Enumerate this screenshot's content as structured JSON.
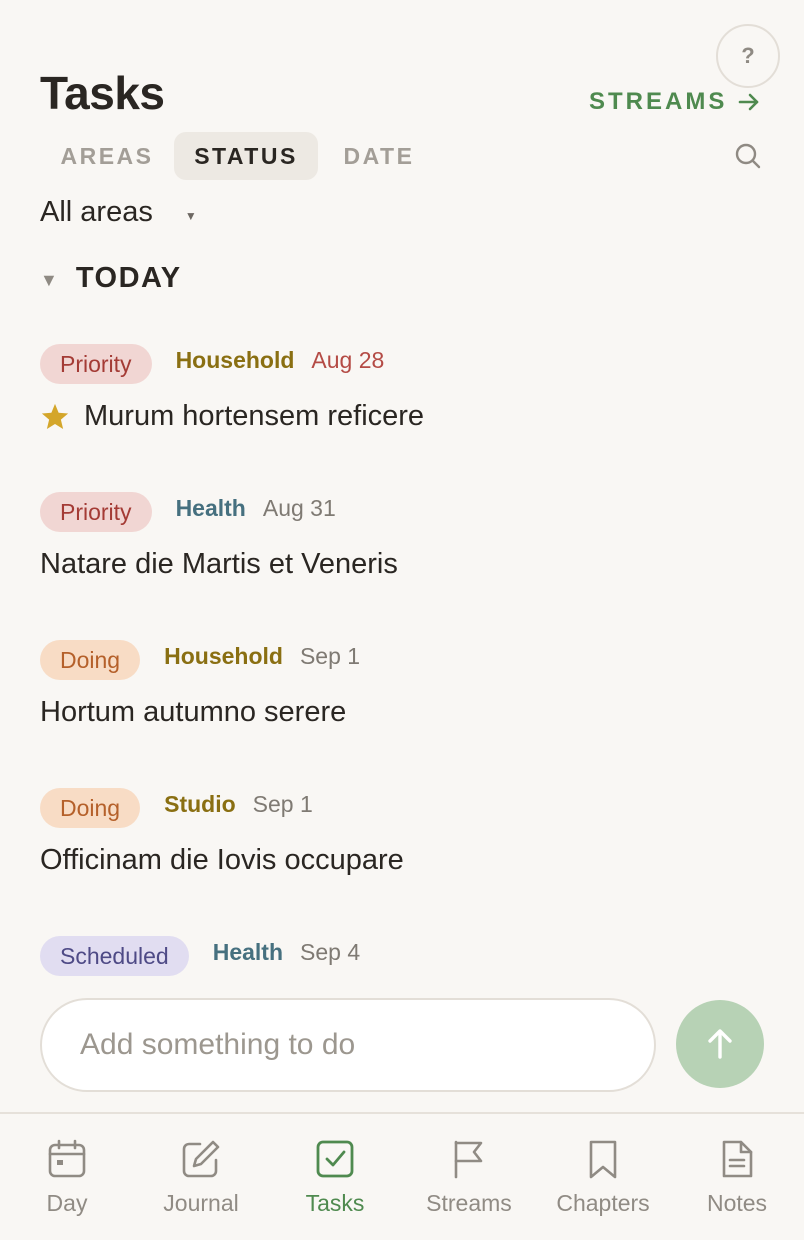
{
  "header": {
    "help_label": "?",
    "title": "Tasks",
    "streams_link": "STREAMS"
  },
  "tabs": [
    {
      "label": "AREAS",
      "active": false
    },
    {
      "label": "STATUS",
      "active": true
    },
    {
      "label": "DATE",
      "active": false
    }
  ],
  "filter": {
    "selected": "All areas"
  },
  "section": {
    "label": "TODAY"
  },
  "tasks": [
    {
      "status": "Priority",
      "area": "Household",
      "date": "Aug 28",
      "date_overdue": true,
      "starred": true,
      "title": "Murum hortensem reficere"
    },
    {
      "status": "Priority",
      "area": "Health",
      "date": "Aug 31",
      "date_overdue": false,
      "starred": false,
      "title": "Natare die Martis et Veneris"
    },
    {
      "status": "Doing",
      "area": "Household",
      "date": "Sep 1",
      "date_overdue": false,
      "starred": false,
      "title": "Hortum autumno serere"
    },
    {
      "status": "Doing",
      "area": "Studio",
      "date": "Sep 1",
      "date_overdue": false,
      "starred": false,
      "title": "Officinam die Iovis occupare"
    },
    {
      "status": "Scheduled",
      "area": "Health",
      "date": "Sep 4",
      "date_overdue": false,
      "starred": false,
      "title": ""
    }
  ],
  "composer": {
    "placeholder": "Add something to do",
    "value": ""
  },
  "nav": [
    {
      "label": "Day",
      "icon": "calendar-icon",
      "active": false
    },
    {
      "label": "Journal",
      "icon": "edit-icon",
      "active": false
    },
    {
      "label": "Tasks",
      "icon": "checkbox-icon",
      "active": true
    },
    {
      "label": "Streams",
      "icon": "flag-icon",
      "active": false
    },
    {
      "label": "Chapters",
      "icon": "bookmark-icon",
      "active": false
    },
    {
      "label": "Notes",
      "icon": "document-icon",
      "active": false
    }
  ],
  "colors": {
    "accent": "#4f8a4f",
    "priority_bg": "#f1d6d3",
    "doing_bg": "#f8dcc5",
    "scheduled_bg": "#e1ddf1",
    "overdue_date": "#b44b45",
    "star": "#d4a62a"
  }
}
